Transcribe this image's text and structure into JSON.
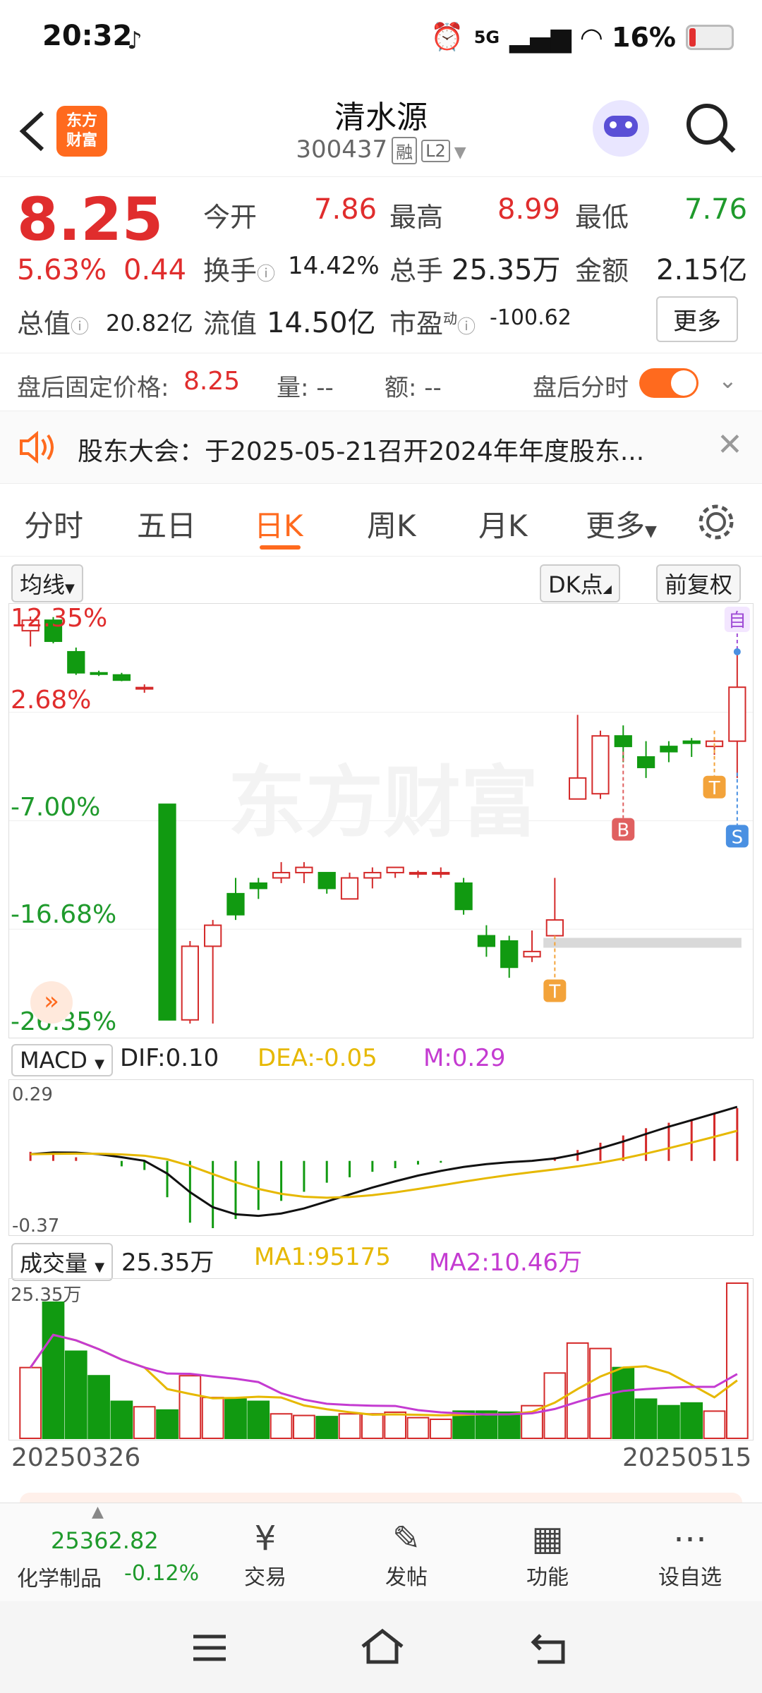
{
  "status": {
    "time": "20:32",
    "network": "5G",
    "battery": "16%"
  },
  "header": {
    "logo_text_1": "东方",
    "logo_text_2": "财富",
    "title": "清水源",
    "code": "300437",
    "tag1": "融",
    "tag2": "L2"
  },
  "quote": {
    "price": "8.25",
    "change_pct": "5.63%",
    "change": "0.44",
    "open_label": "今开",
    "open": "7.86",
    "high_label": "最高",
    "high": "8.99",
    "low_label": "最低",
    "low": "7.76",
    "turnover_label": "换手",
    "turnover": "14.42%",
    "volume_label": "总手",
    "volume": "25.35万",
    "amount_label": "金额",
    "amount": "2.15亿",
    "mcap_label": "总值",
    "mcap": "20.82亿",
    "float_label": "流值",
    "float": "14.50亿",
    "pe_label": "市盈",
    "pe_sup": "动",
    "pe": "-100.62",
    "more": "更多"
  },
  "afterhours": {
    "price_label": "盘后固定价格:",
    "price": "8.25",
    "vol_label": "量: --",
    "amt_label": "额: --",
    "toggle_label": "盘后分时"
  },
  "notice": {
    "text": "股东大会：于2025-05-21召开2024年年度股东..."
  },
  "tabs": [
    "分时",
    "五日",
    "日K",
    "周K",
    "月K",
    "更多"
  ],
  "chart_toolbar": {
    "ma": "均线",
    "dk": "DK点",
    "adj": "前复权"
  },
  "kline": {
    "y_labels": [
      "12.35%",
      "2.68%",
      "-7.00%",
      "-16.68%",
      "-26.35%"
    ],
    "watermark": "东方财富",
    "markers": {
      "b": "B",
      "s": "S",
      "t": "T",
      "self": "自"
    }
  },
  "macd": {
    "selector": "MACD",
    "dif": "DIF:0.10",
    "dea": "DEA:-0.05",
    "m": "M:0.29",
    "top": "0.29",
    "bottom": "-0.37"
  },
  "volume_panel": {
    "selector": "成交量",
    "value": "25.35万",
    "ma1": "MA1:95175",
    "ma2": "MA2:10.46万",
    "top": "25.35万"
  },
  "dates": {
    "start": "20250326",
    "end": "20250515"
  },
  "bottom": {
    "index_value": "25362.82",
    "index_name": "化学制品",
    "index_change": "-0.12%",
    "trade": "交易",
    "post": "发帖",
    "func": "功能",
    "watch": "设自选"
  },
  "chart_data": {
    "type": "candlestick",
    "series": [
      {
        "name": "candles",
        "values": [
          [
            11.0,
            12.0,
            12.35,
            9.5
          ],
          [
            12.0,
            10.0,
            12.3,
            9.8
          ],
          [
            9.0,
            7.0,
            9.4,
            6.8
          ],
          [
            7.0,
            6.9,
            7.2,
            6.7
          ],
          [
            6.8,
            6.3,
            7.0,
            6.2
          ],
          [
            5.5,
            5.6,
            5.9,
            5.1
          ],
          [
            -5.5,
            -26.0,
            -5.5,
            -26.0
          ],
          [
            -26.0,
            -19.0,
            -18.5,
            -26.35
          ],
          [
            -19.0,
            -17.0,
            -16.5,
            -26.35
          ],
          [
            -14.0,
            -16.0,
            -12.5,
            -16.5
          ],
          [
            -13.0,
            -13.5,
            -12.5,
            -14.5
          ],
          [
            -12.5,
            -12.0,
            -11.0,
            -13.0
          ],
          [
            -12.0,
            -11.5,
            -11.0,
            -13.0
          ],
          [
            -12.0,
            -13.5,
            -12.0,
            -14.0
          ],
          [
            -14.5,
            -12.5,
            -12.0,
            -14.5
          ],
          [
            -12.5,
            -12.0,
            -11.5,
            -13.5
          ],
          [
            -12.0,
            -11.5,
            -11.5,
            -12.5
          ],
          [
            -12.0,
            -12.0,
            -11.8,
            -12.5
          ],
          [
            -12.0,
            -12.0,
            -11.5,
            -12.5
          ],
          [
            -13.0,
            -15.5,
            -12.5,
            -16.0
          ],
          [
            -18.0,
            -19.0,
            -17.0,
            -20.0
          ],
          [
            -18.5,
            -21.0,
            -18.0,
            -22.0
          ],
          [
            -20.0,
            -19.5,
            -17.5,
            -20.5
          ],
          [
            -18.0,
            -16.5,
            -12.5,
            -18.0
          ],
          [
            -5.0,
            -3.0,
            3.0,
            -5.0
          ],
          [
            -4.5,
            1.0,
            1.5,
            -5.0
          ],
          [
            1.0,
            0.0,
            2.0,
            -1.5
          ],
          [
            -1.0,
            -2.0,
            0.5,
            -3.0
          ],
          [
            0.0,
            -0.5,
            0.5,
            -1.5
          ],
          [
            0.5,
            0.3,
            0.8,
            -1.0
          ],
          [
            0.0,
            0.5,
            0.8,
            -0.8
          ],
          [
            0.5,
            5.63,
            9.0,
            -3.0
          ]
        ]
      }
    ],
    "macd_bars": [
      0.05,
      0.04,
      0.02,
      0.0,
      -0.03,
      -0.05,
      -0.2,
      -0.34,
      -0.37,
      -0.32,
      -0.27,
      -0.22,
      -0.17,
      -0.12,
      -0.09,
      -0.06,
      -0.04,
      -0.02,
      -0.01,
      0.0,
      0.0,
      0.0,
      0.0,
      0.02,
      0.06,
      0.1,
      0.14,
      0.18,
      0.21,
      0.23,
      0.26,
      0.29
    ],
    "volume": [
      130,
      250,
      160,
      115,
      68,
      58,
      52,
      115,
      75,
      72,
      68,
      45,
      42,
      40,
      45,
      45,
      48,
      38,
      35,
      50,
      50,
      48,
      60,
      120,
      175,
      165,
      130,
      72,
      60,
      65,
      50,
      285
    ],
    "ylim": [
      -26.35,
      12.35
    ]
  }
}
